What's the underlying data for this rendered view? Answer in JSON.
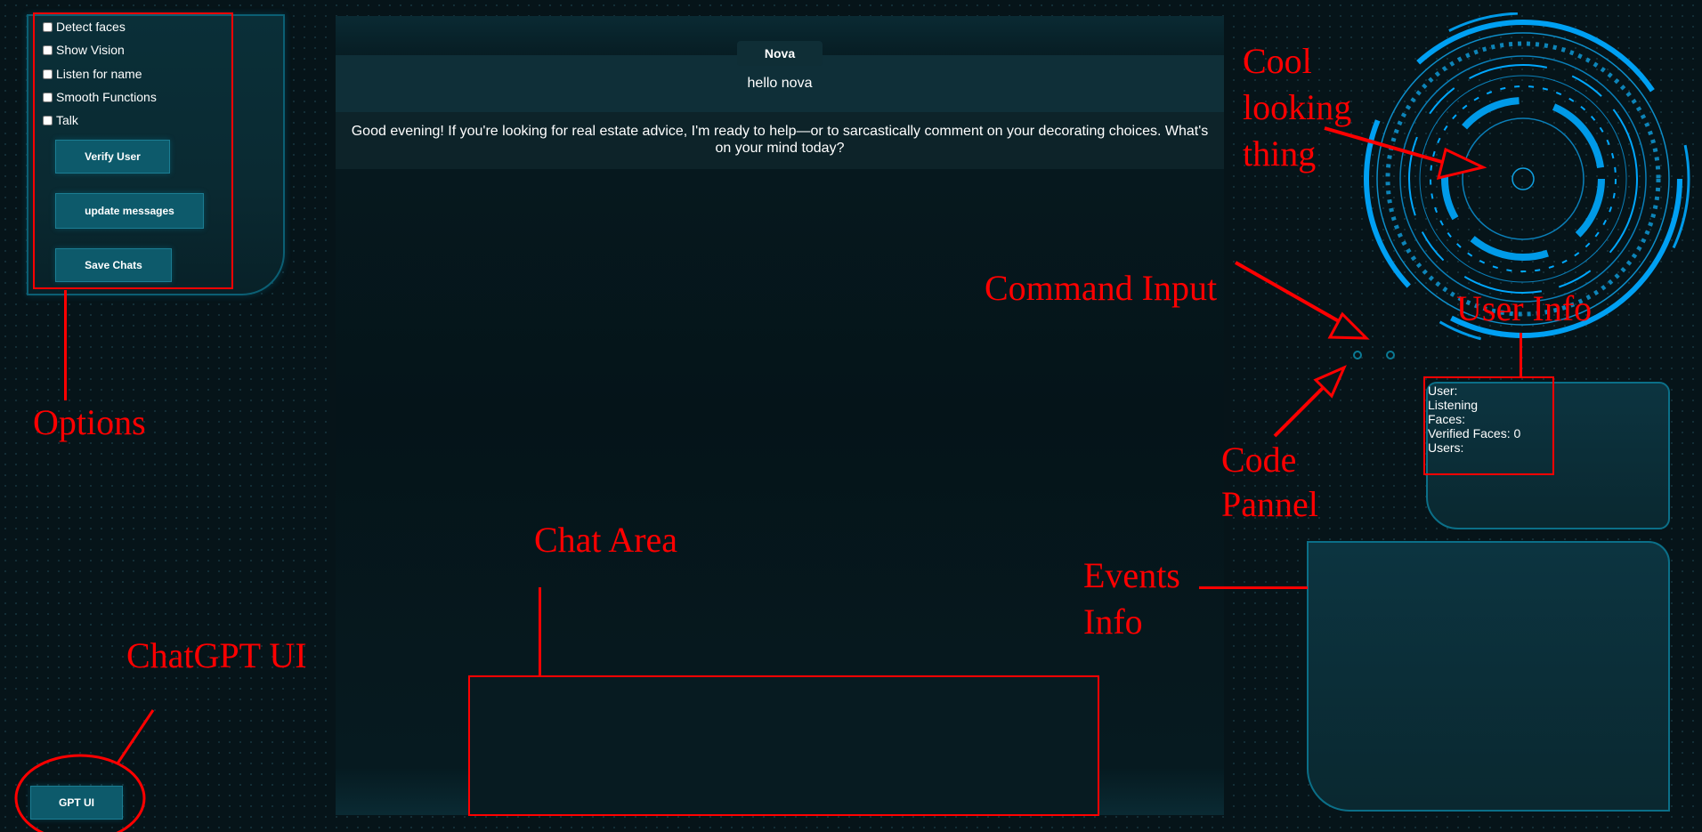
{
  "options": {
    "checkboxes": [
      "Detect faces",
      "Show Vision",
      "Listen for name",
      "Smooth Functions",
      "Talk"
    ],
    "verify_button": "Verify User",
    "update_button": "update messages",
    "save_button": "Save Chats"
  },
  "chat": {
    "assistant_name": "Nova",
    "user_message": "hello nova",
    "assistant_message": "Good evening! If you're looking for real estate advice, I'm ready to help—or to sarcastically comment on your decorating choices. What's on your mind today?"
  },
  "gpt_ui_button": "GPT UI",
  "user_info": {
    "user": "User:",
    "status": "Listening",
    "faces": "Faces:",
    "verified_faces": "Verified Faces: 0",
    "users": "Users:"
  },
  "annotations": {
    "options": "Options",
    "chatgpt_ui": "ChatGPT UI",
    "chat_area": "Chat Area",
    "command_input": "Command Input",
    "code_panel_1": "Code",
    "code_panel_2": "Pannel",
    "cool_1": "Cool",
    "cool_2": "looking",
    "cool_3": "thing",
    "user_info": "User Info",
    "events_1": "Events",
    "events_2": "Info"
  },
  "colors": {
    "background": "#061419",
    "panel_border": "#0b6f88",
    "accent": "#00a8ff",
    "annotation": "#ff0000"
  }
}
